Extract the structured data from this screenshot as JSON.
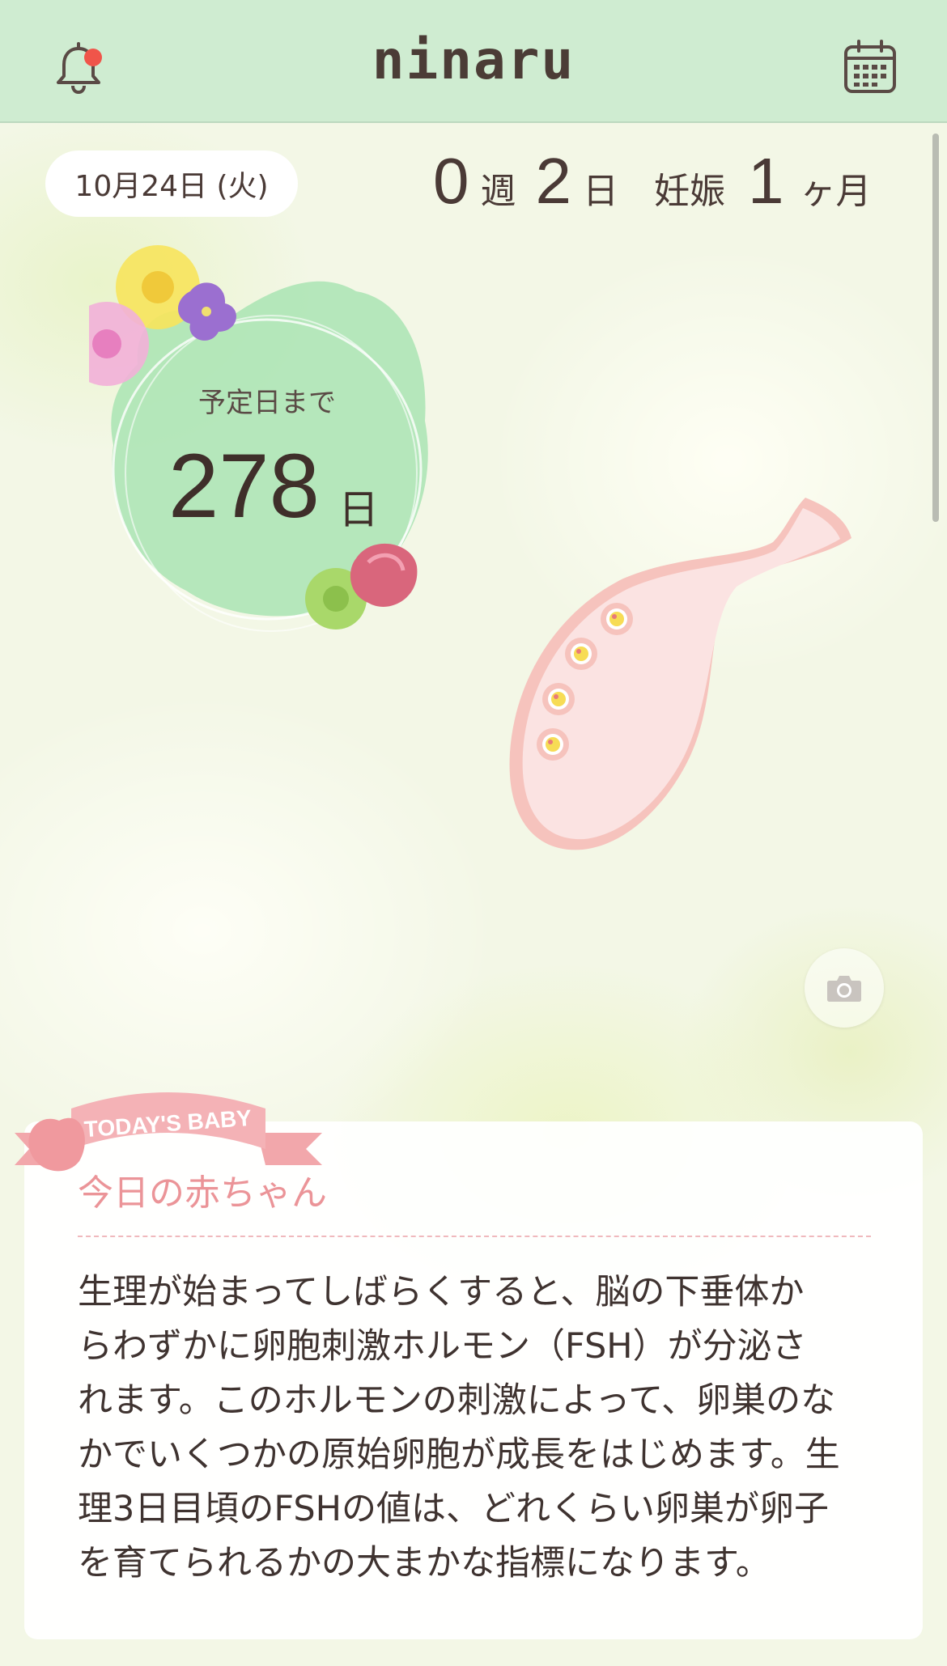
{
  "app": {
    "title": "ninaru"
  },
  "header": {
    "has_notification": true
  },
  "date": {
    "label": "10月24日 (火)"
  },
  "pregnancy": {
    "weeks": "0",
    "weeks_unit": "週",
    "days": "2",
    "days_unit": "日",
    "month_prefix": "妊娠",
    "months": "1",
    "months_unit": "ヶ月"
  },
  "countdown": {
    "label": "予定日まで",
    "days": "278",
    "unit": "日"
  },
  "baby_card": {
    "ribbon_text": "TODAY'S BABY",
    "title": "今日の赤ちゃん",
    "lines": [
      "生理が始まってしばらくすると、脳の下垂体か",
      "らわずかに卵胞刺激ホルモン（FSH）が分泌さ",
      "れます。このホルモンの刺激によって、卵巣のな",
      "かでいくつかの原始卵胞が成長をはじめます。生",
      "理3日目頃のFSHの値は、どれくらい卵巣が卵子",
      "を育てられるかの大まかな指標になります。"
    ]
  },
  "icons": {
    "notification": "bell-icon",
    "calendar": "calendar-icon",
    "camera": "camera-icon"
  },
  "colors": {
    "header_bg": "#cfecd1",
    "accent_pink": "#eb9498",
    "notification_dot": "#f0554a"
  }
}
